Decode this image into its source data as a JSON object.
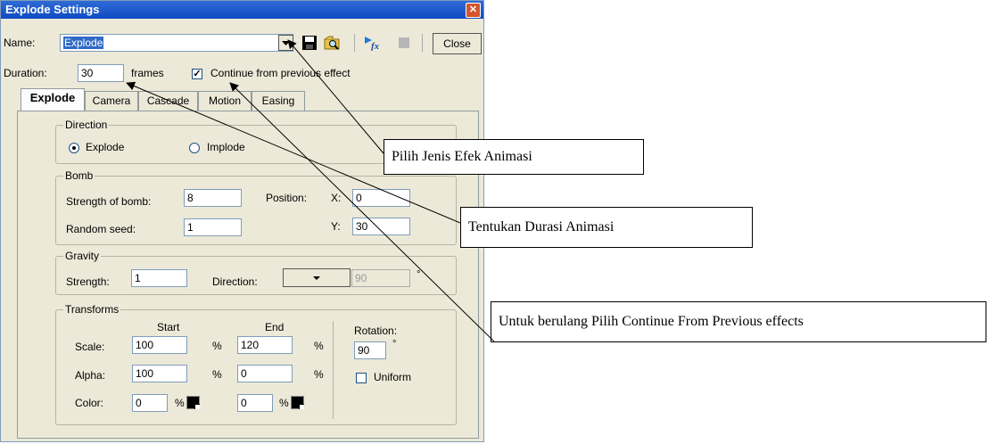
{
  "window": {
    "title": "Explode Settings",
    "close_x": "✕"
  },
  "toolbar": {
    "name_label": "Name:",
    "name_value": "Explode",
    "close_label": "Close"
  },
  "duration": {
    "label": "Duration:",
    "value": "30",
    "unit": "frames",
    "continue_label": "Continue from previous effect",
    "continue_checked": "✓"
  },
  "tabs": [
    "Explode",
    "Camera",
    "Cascade",
    "Motion",
    "Easing"
  ],
  "direction": {
    "title": "Direction",
    "explode_label": "Explode",
    "implode_label": "Implode"
  },
  "bomb": {
    "title": "Bomb",
    "strength_label": "Strength of bomb:",
    "strength_value": "8",
    "seed_label": "Random seed:",
    "seed_value": "1",
    "position_label": "Position:",
    "x_label": "X:",
    "x_value": "0",
    "y_label": "Y:",
    "y_value": "30"
  },
  "gravity": {
    "title": "Gravity",
    "strength_label": "Strength:",
    "strength_value": "1",
    "direction_label": "Direction:",
    "direction_value": "90",
    "degree": "°"
  },
  "transforms": {
    "title": "Transforms",
    "start_header": "Start",
    "end_header": "End",
    "rotation_label": "Rotation:",
    "rotation_value": "90",
    "degree": "°",
    "scale_label": "Scale:",
    "scale_start": "100",
    "scale_end": "120",
    "alpha_label": "Alpha:",
    "alpha_start": "100",
    "alpha_end": "0",
    "color_label": "Color:",
    "color_start": "0",
    "color_end": "0",
    "percent": "%",
    "uniform_label": "Uniform"
  },
  "callouts": {
    "effect": "Pilih Jenis Efek Animasi",
    "duration": "Tentukan Durasi Animasi",
    "continue": "Untuk berulang Pilih Continue From Previous effects"
  },
  "colors": {
    "title_bar": "#0f4bc3",
    "selection": "#316ac5",
    "dialog_bg": "#ece9d8"
  },
  "icons": [
    "dropdown-arrow-icon",
    "save-disk-icon",
    "search-folder-icon",
    "effect-fx-icon",
    "stop-icon"
  ]
}
